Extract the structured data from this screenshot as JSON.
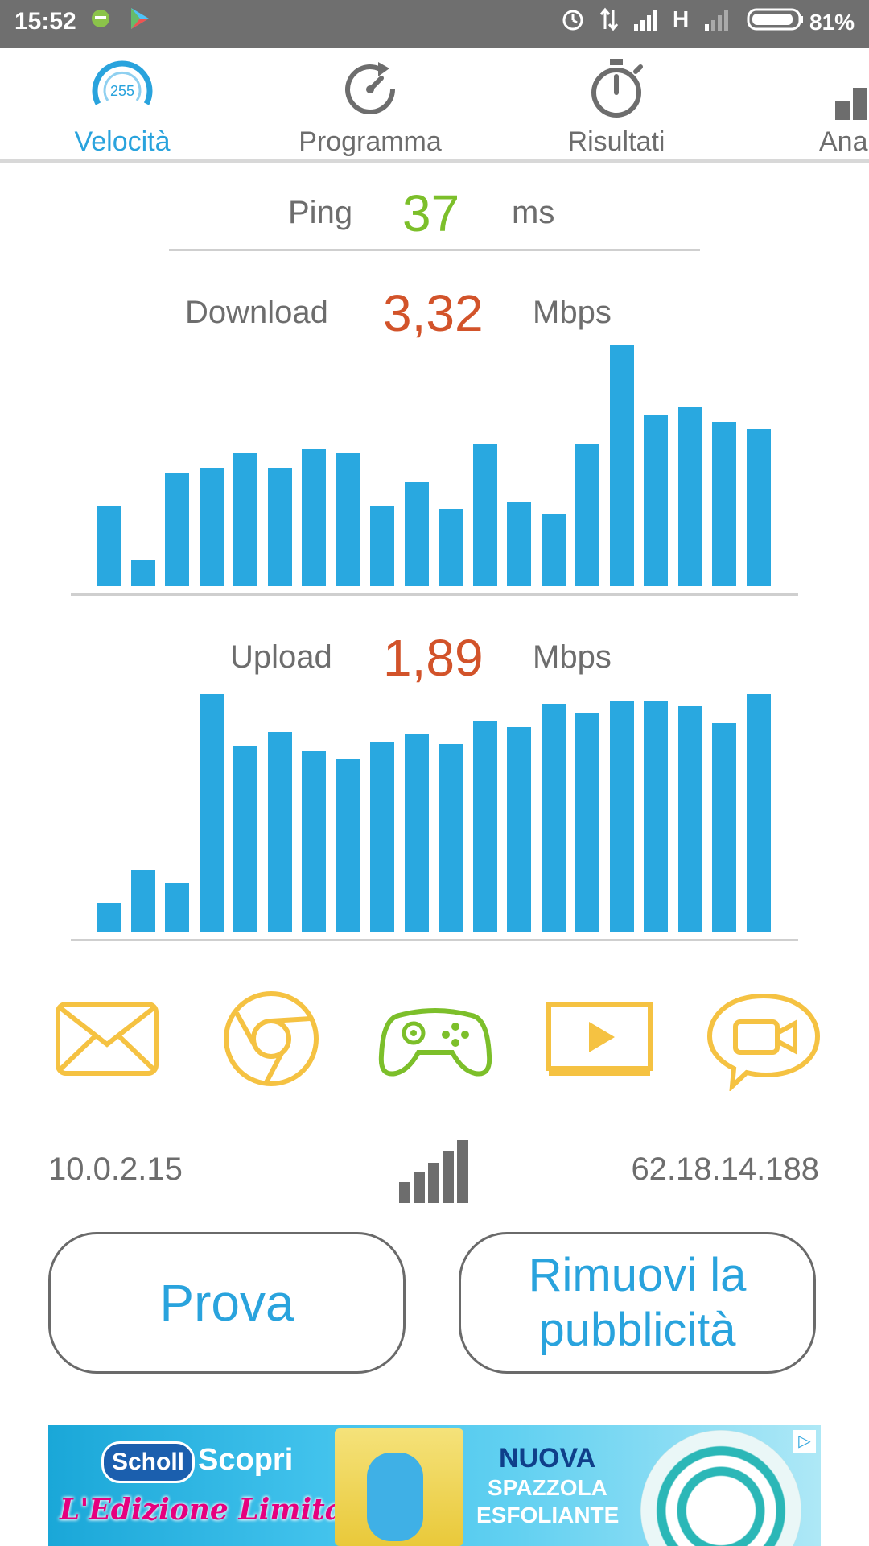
{
  "status_bar": {
    "time": "15:52",
    "network_type": "H",
    "battery_percent": "81%"
  },
  "tabs": [
    {
      "label": "Velocità",
      "active": true,
      "gauge_text": "255"
    },
    {
      "label": "Programma",
      "active": false
    },
    {
      "label": "Risultati",
      "active": false
    },
    {
      "label": "Ana",
      "active": false
    }
  ],
  "ping": {
    "label": "Ping",
    "value": "37",
    "unit": "ms",
    "color": "#7cbf2a"
  },
  "download": {
    "label": "Download",
    "value": "3,32",
    "unit": "Mbps",
    "color": "#d2532a",
    "bars": [
      0.33,
      0.11,
      0.47,
      0.49,
      0.55,
      0.49,
      0.57,
      0.55,
      0.33,
      0.43,
      0.32,
      0.59,
      0.35,
      0.3,
      0.59,
      1.0,
      0.71,
      0.74,
      0.68,
      0.65
    ]
  },
  "upload": {
    "label": "Upload",
    "value": "1,89",
    "unit": "Mbps",
    "color": "#d2532a",
    "bars": [
      0.12,
      0.26,
      0.21,
      1.0,
      0.78,
      0.84,
      0.76,
      0.73,
      0.8,
      0.83,
      0.79,
      0.89,
      0.86,
      0.96,
      0.92,
      0.97,
      0.97,
      0.95,
      0.88,
      1.0
    ]
  },
  "activities": [
    {
      "icon": "email-icon",
      "color": "#f5c242"
    },
    {
      "icon": "browser-icon",
      "color": "#f5c242"
    },
    {
      "icon": "gamepad-icon",
      "color": "#7cbf2a"
    },
    {
      "icon": "video-icon",
      "color": "#f5c242"
    },
    {
      "icon": "video-call-icon",
      "color": "#f5c242"
    }
  ],
  "network": {
    "local_ip": "10.0.2.15",
    "public_ip": "62.18.14.188"
  },
  "buttons": {
    "test": "Prova",
    "remove_ads_line1": "Rimuovi la",
    "remove_ads_line2": "pubblicità"
  },
  "ad": {
    "brand": "Scholl",
    "cta": "Scopri",
    "tagline": "L'Edizione Limitata",
    "headline1": "NUOVA",
    "headline2": "SPAZZOLA",
    "headline3": "ESFOLIANTE"
  },
  "colors": {
    "accent": "#29a3dd",
    "bar": "#29a8e0"
  }
}
